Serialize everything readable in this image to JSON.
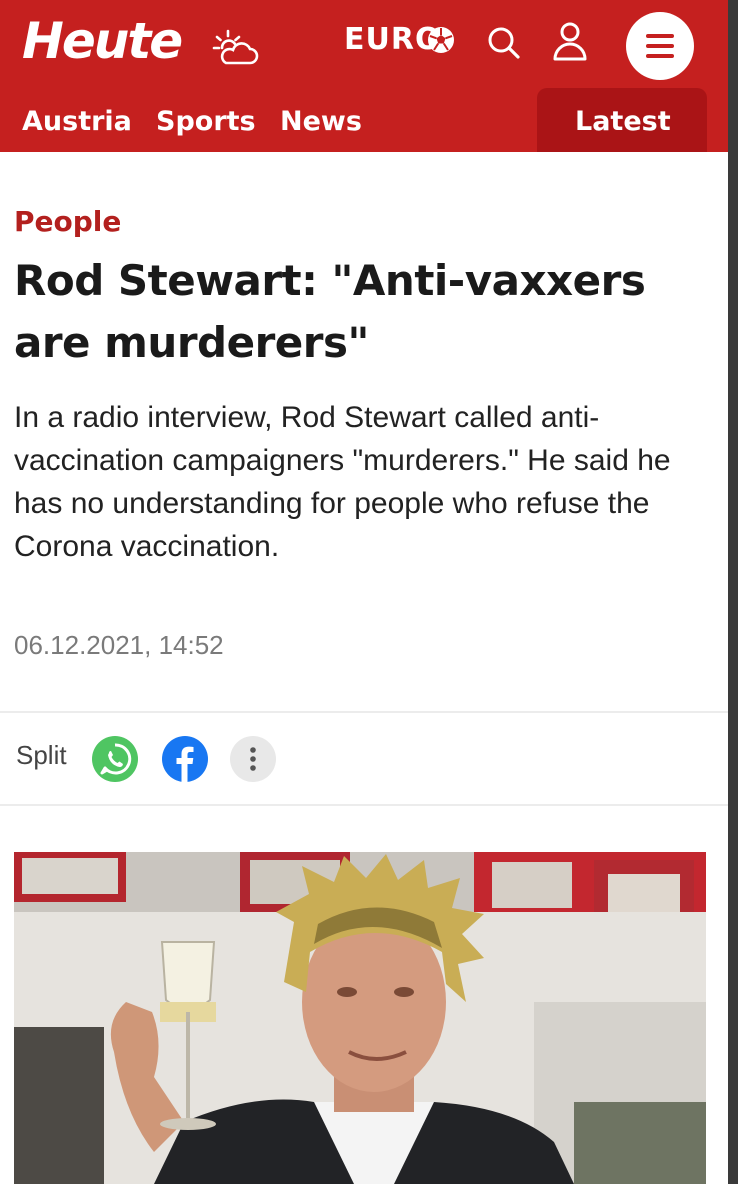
{
  "header": {
    "logo": "Heute",
    "euro_label": "EURO",
    "icons": {
      "weather": "weather-cloud-sun-icon",
      "ball": "football-icon",
      "search": "search-icon",
      "account": "user-icon",
      "menu": "menu-icon"
    },
    "brand_color": "#c5201f",
    "nav": [
      {
        "label": "Austria"
      },
      {
        "label": "Sports"
      },
      {
        "label": "News"
      }
    ],
    "latest_label": "Latest"
  },
  "article": {
    "kicker": "People",
    "headline": "Rod Stewart: \"Anti-vaxxers are murderers\"",
    "lead": "In a radio interview, Rod Stewart called anti-vaccination campaigners \"murderers.\" He said he has no understanding for people who refuse the Corona vaccination.",
    "date": "06.12.2021, 14:52"
  },
  "share": {
    "label": "Split",
    "icons": [
      "whatsapp-icon",
      "facebook-icon",
      "more-options-icon"
    ]
  },
  "image": {
    "subject": "photo-man-raising-champagne-glass"
  }
}
